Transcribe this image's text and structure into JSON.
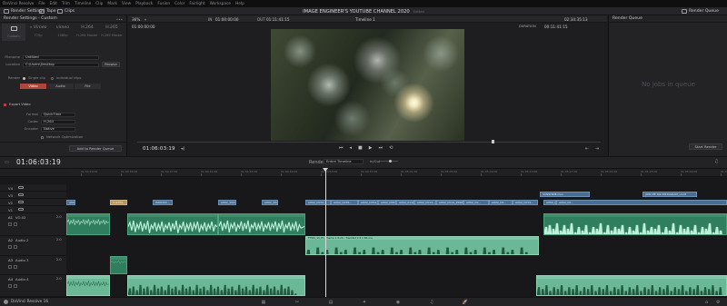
{
  "app_menu": [
    "DaVinci Resolve",
    "File",
    "Edit",
    "Trim",
    "Timeline",
    "Clip",
    "Mark",
    "View",
    "Playback",
    "Fusion",
    "Color",
    "Fairlight",
    "Workspace",
    "Help"
  ],
  "toolbar": {
    "render_settings": "Render Settings",
    "tape": "Tape",
    "clips": "Clips",
    "project_title": "IMAGE ENGINEER'S YOUTUBE CHANNEL 2020",
    "edited": "Edited",
    "render_queue": "Render Queue"
  },
  "render_settings": {
    "header": "Render Settings - Custom",
    "presets": [
      {
        "icon": "",
        "label": "Custom"
      },
      {
        "icon": "» Vimeo",
        "label": "720p"
      },
      {
        "icon": "vimeo",
        "label": "1080p"
      },
      {
        "icon": "H.264",
        "label": "H.264 Master"
      },
      {
        "icon": "H.265",
        "label": "H.265 Master"
      }
    ],
    "filename_label": "Filename",
    "filename": "Untitled",
    "location_label": "Location",
    "location": "C:\\Users\\Desktop",
    "browse": "Browse",
    "render_label": "Render",
    "single_clip": "Single clip",
    "individual_clips": "Individual clips",
    "tabs": [
      "Video",
      "Audio",
      "File"
    ],
    "export_video": "Export Video",
    "format_label": "Format",
    "format": "QuickTime",
    "codec_label": "Codec",
    "codec": "H.264",
    "encoder_label": "Encoder",
    "encoder": "Native",
    "network": "Network Optimization",
    "add_to_queue": "Add to Render Queue"
  },
  "viewer": {
    "zoom": "36%",
    "in_label": "IN",
    "in_tc": "01:00:00:00",
    "out_label": "OUT",
    "out_tc": "01:11:41:15",
    "timeline_name": "Timeline 1",
    "duration_tc": "02:34:35:13",
    "duration_label": "DURATION",
    "duration_tc2": "00:11:41:15",
    "current_tc": "01:06:03:19"
  },
  "render_queue": {
    "header": "Render Queue",
    "empty": "No jobs in queue",
    "start": "Start Render"
  },
  "timeline": {
    "current_tc": "01:06:03:19",
    "render_label": "Render",
    "render_mode": "Entire Timeline",
    "in_out": "In/Out",
    "ruler": [
      "01:04:29:00",
      "01:04:33:00",
      "01:04:37:00",
      "01:04:41:00",
      "01:04:45:00",
      "01:04:49:00",
      "01:04:53:00",
      "01:04:57:00",
      "01:05:01:00",
      "01:05:05:00",
      "01:05:09:00",
      "01:05:13:00",
      "01:05:17:00",
      "01:05:21:00",
      "01:05:25:00",
      "01:05:29:00",
      "01:05:33:00"
    ],
    "video_tracks": [
      "V4",
      "V3",
      "V2",
      "V1"
    ],
    "audio_tracks": [
      {
        "id": "A1",
        "name": "VO.02",
        "tag": "2.0"
      },
      {
        "id": "A2",
        "name": "Audio 2",
        "tag": "2.0"
      },
      {
        "id": "A3",
        "name": "Audio 3",
        "tag": "2.0"
      },
      {
        "id": "A4",
        "name": "Audio 4",
        "tag": "2.0"
      }
    ],
    "v4_clips": [
      "SUNSHINE.mov",
      "JOIN ME ON INSTAGRAM_v4.tif"
    ],
    "v1_clips": [
      "A002_C0...",
      "Subtitle",
      "ISO6400...",
      "A002_1024...",
      "A002_1026...",
      "A002_C034...",
      "A002_C038...",
      "A002_C054...",
      "A002_C064...",
      "A002_0110...",
      "A002_C014...",
      "A002_C019_25664.mov",
      "A002_C0...",
      "A002_C0...",
      "A002_C019...",
      "A002_C0...",
      "A002_C0..."
    ],
    "a2_clip_label": "TTWS_10_P1_Theme 1 0:26 - Tracklist 1 8 C 86 ma"
  },
  "bottom": {
    "app_name": "DaVinci Resolve 16",
    "pages": [
      "media-page-icon",
      "cut-page-icon",
      "edit-page-icon",
      "fusion-page-icon",
      "color-page-icon",
      "fairlight-page-icon",
      "deliver-page-icon"
    ]
  }
}
